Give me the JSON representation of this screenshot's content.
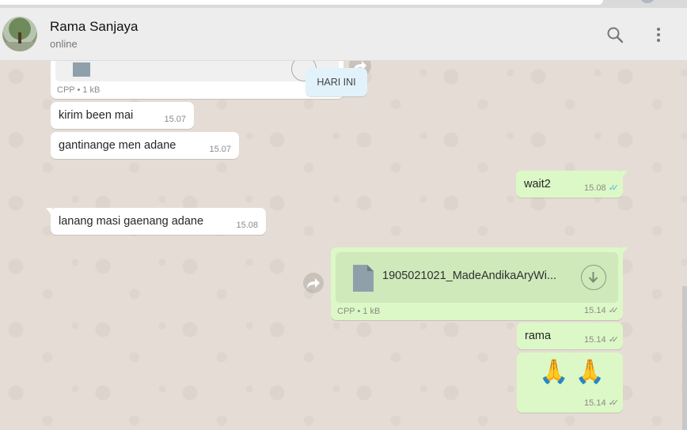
{
  "contact": {
    "name": "Rama Sanjaya",
    "status": "online"
  },
  "header_icons": [
    "search-icon",
    "menu-dots-icon"
  ],
  "date_divider": "HARI INI",
  "messages": {
    "file_in": {
      "meta": "CPP • 1 kB"
    },
    "m1": {
      "text": "kirim been mai",
      "time": "15.07"
    },
    "m2": {
      "text": "gantinange men adane",
      "time": "15.07"
    },
    "m3": {
      "text": "wait2",
      "time": "15.08",
      "ticks": "✓✓"
    },
    "m4": {
      "text": "lanang masi gaenang adane",
      "time": "15.08"
    },
    "file_out": {
      "name": "1905021021_MadeAndikaAryWi...",
      "meta": "CPP • 1 kB",
      "time": "15.14",
      "ticks": "✓✓"
    },
    "m5": {
      "text": "rama",
      "time": "15.14",
      "ticks": "✓✓"
    },
    "m6": {
      "emoji": "🙏 🙏",
      "time": "15.14",
      "ticks": "✓✓"
    }
  },
  "colors": {
    "incoming": "#ffffff",
    "outgoing": "#dcf8c6",
    "read_ticks": "#4fb6ec",
    "header_bg": "#ededed"
  }
}
